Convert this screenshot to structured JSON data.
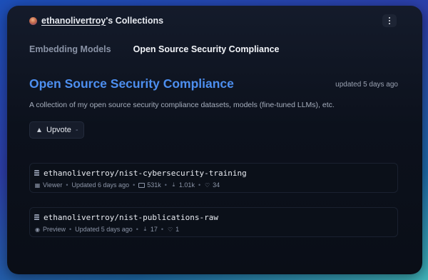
{
  "header": {
    "username": "ethanolivertroy",
    "title_suffix": "'s Collections"
  },
  "tabs": [
    {
      "label": "Embedding Models"
    },
    {
      "label": "Open Source Security Compliance"
    }
  ],
  "collection": {
    "title": "Open Source Security Compliance",
    "updated": "updated 5 days ago",
    "description": "A collection of my open source security compliance datasets, models (fine-tuned LLMs), etc.",
    "upvote_label": "Upvote",
    "upvote_count": "-"
  },
  "items": [
    {
      "name": "ethanolivertroy/nist-cybersecurity-training",
      "mode": "Viewer",
      "updated": "Updated 6 days ago",
      "rows": "531k",
      "downloads": "1.01k",
      "likes": "34"
    },
    {
      "name": "ethanolivertroy/nist-publications-raw",
      "mode": "Preview",
      "updated": "Updated 5 days ago",
      "downloads": "17",
      "likes": "1"
    }
  ],
  "icons": {
    "avatar": "avatar",
    "menu": "kebab-menu-icon",
    "upvote": "upvote-triangle-icon",
    "dataset": "dataset-icon",
    "viewer": "table-icon",
    "preview": "eye-icon",
    "rows": "rows-icon",
    "downloads": "download-icon",
    "likes": "heart-icon"
  },
  "colors": {
    "accent": "#4d8ff0",
    "card_bg": "#0c111c"
  }
}
